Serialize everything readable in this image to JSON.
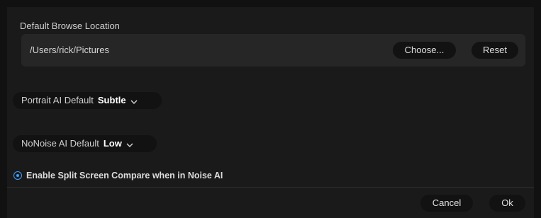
{
  "browse": {
    "section_label": "Default Browse Location",
    "path": "/Users/rick/Pictures",
    "choose_label": "Choose...",
    "reset_label": "Reset"
  },
  "portrait": {
    "label": "Portrait AI Default",
    "value": "Subtle"
  },
  "nonoise": {
    "label": "NoNoise AI Default",
    "value": "Low"
  },
  "split_screen": {
    "label": "Enable Split Screen Compare when in Noise AI",
    "checked": true
  },
  "footer": {
    "cancel_label": "Cancel",
    "ok_label": "Ok"
  },
  "colors": {
    "accent": "#3aa0ff",
    "background": "#1a1a1a",
    "pill": "#121212"
  },
  "icons": {
    "dropdown": "chevron-down-icon",
    "radio": "radio-selected-icon"
  }
}
